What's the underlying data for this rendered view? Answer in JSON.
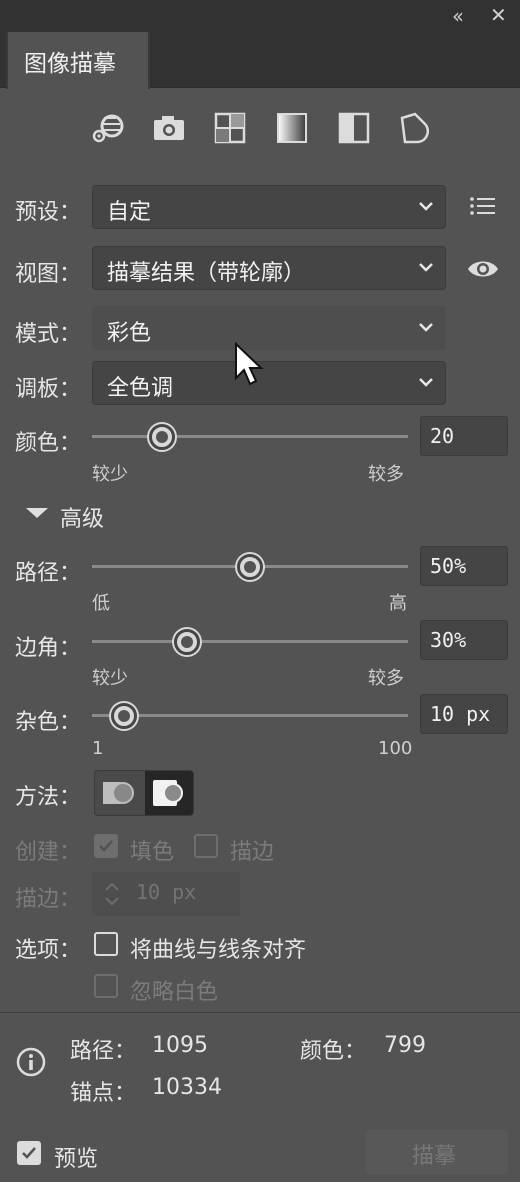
{
  "window": {
    "collapse_glyph": "‹‹",
    "close_glyph": "✕",
    "tab_title": "图像描摹"
  },
  "icons": [
    "auto-color-icon",
    "camera-icon",
    "grayscale-grid-icon",
    "gradient-icon",
    "black-white-icon",
    "outline-shape-icon"
  ],
  "fields": {
    "preset": {
      "label": "预设：",
      "value": "自定"
    },
    "view": {
      "label": "视图：",
      "value": "描摹结果（带轮廓）"
    },
    "mode": {
      "label": "模式：",
      "value": "彩色"
    },
    "palette": {
      "label": "调板：",
      "value": "全色调"
    }
  },
  "colors_slider": {
    "label": "颜色：",
    "value": "20",
    "min_label": "较少",
    "max_label": "较多",
    "level": 0.22
  },
  "advanced": {
    "toggle_label": "高级",
    "paths": {
      "label": "路径：",
      "value": "50%",
      "min_label": "低",
      "max_label": "高",
      "level": 0.5
    },
    "corners": {
      "label": "边角：",
      "value": "30%",
      "min_label": "较少",
      "max_label": "较多",
      "level": 0.3
    },
    "noise": {
      "label": "杂色：",
      "value": "10 px",
      "min_label": "1",
      "max_label": "100",
      "level": 0.1
    },
    "method": {
      "label": "方法：",
      "selected": "overlapping"
    },
    "create": {
      "label": "创建：",
      "fill_label": "填色",
      "fill_checked": true,
      "stroke_label": "描边",
      "stroke_checked": false
    },
    "stroke": {
      "label": "描边：",
      "value": "10 px"
    },
    "options": {
      "label": "选项：",
      "snap_label": "将曲线与线条对齐",
      "snap_checked": false,
      "ignore_white_label": "忽略白色",
      "ignore_white_checked": false
    }
  },
  "stats": {
    "paths_label": "路径：",
    "paths_value": "1095",
    "colors_label": "颜色：",
    "colors_value": "799",
    "anchors_label": "锚点：",
    "anchors_value": "10334"
  },
  "footer": {
    "preview_label": "预览",
    "preview_checked": true,
    "trace_button": "描摹"
  },
  "accent": "#dcdcdc"
}
